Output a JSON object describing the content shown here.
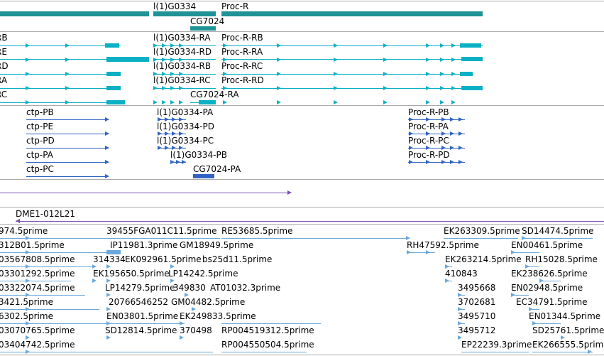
{
  "colors": {
    "gene": "#1f9396",
    "mrna": "#0ab0c4",
    "cds": "#3163c4",
    "clone": "#7a52b4",
    "est": "#6aa8dc",
    "border": "#aaaaaa"
  },
  "gene_track": {
    "labels": [
      "l(1)G0334",
      "Proc-R",
      "CG7024"
    ]
  },
  "mrna_track": {
    "labels": [
      "RB",
      "RE",
      "RD",
      "RA",
      "RC",
      "l(1)G0334-RA",
      "l(1)G0334-RD",
      "l(1)G0334-RB",
      "l(1)G0334-RC",
      "CG7024-RA",
      "Proc-R-RB",
      "Proc-R-RA",
      "Proc-R-RC",
      "Proc-R-RD"
    ]
  },
  "cds_track": {
    "labels": [
      "ctp-PB",
      "ctp-PE",
      "ctp-PD",
      "ctp-PA",
      "ctp-PC",
      "l(1)G0334-PA",
      "l(1)G0334-PD",
      "l(1)G0334-PC",
      "l(1)G0334-PB",
      "CG7024-PA",
      "Proc-R-PB",
      "Proc-R-PA",
      "Proc-R-PC",
      "Proc-R-PD"
    ]
  },
  "clone_track": {
    "labels": [
      "DME1-012L21"
    ]
  },
  "est_track": {
    "labels": [
      "974.5prime",
      "39455FGA011C11.5prime",
      "RE53685.5prime",
      "EK263309.5prime",
      "SD14474.5prime",
      "312B01.5prime",
      "IP11981.3prime",
      "GM18949.5prime",
      "RH47592.5prime",
      "EN00461.5prime",
      "03567808.5prime",
      "314334",
      "EK092961.5prime",
      "bs25d11.5prime",
      "EK263214.5prime",
      "RH15028.5prime",
      "03301292.5prime",
      "EK195650.5prime",
      "LP14242.5prime",
      "410843",
      "EK238626.5prime",
      "03322074.5prime",
      "LP14279.5prime",
      "349830",
      "AT01032.3prime",
      "3495668",
      "EN02948.5prime",
      "3421.5prime",
      "20766546252",
      "GM04482.5prime",
      "3702681",
      "EC34791.5prime",
      "6302.5prime",
      "EN03801.5prime",
      "EK249833.5prime",
      "3495710",
      "EN01344.5prime",
      "03070765.5prime",
      "SD12814.5prime",
      "370498",
      "RP004519312.5prime",
      "3495712",
      "SD25761.5prime",
      "03404742.5prime",
      "RP004550504.5prime",
      "EP22239.3prime",
      "EK266555.5prime"
    ]
  }
}
